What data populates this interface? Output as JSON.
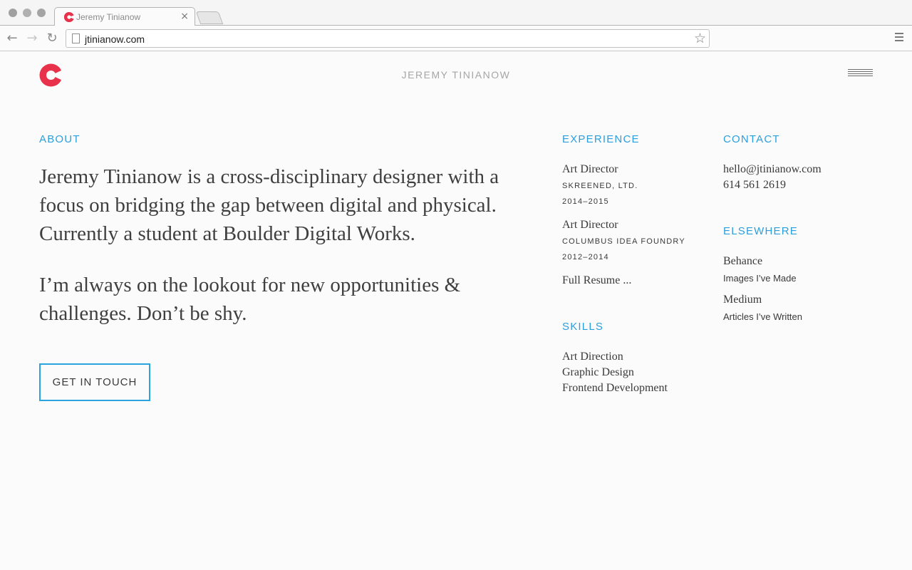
{
  "browser": {
    "tab_title": "Jeremy Tinianow",
    "tab_close": "×",
    "url": "jtinianow.com",
    "back_icon": "arrow-left-icon",
    "forward_icon": "arrow-right-icon",
    "reload_icon": "reload-icon",
    "star_icon": "star-icon",
    "menu_icon": "menu-icon",
    "brand_color": "#e8324b"
  },
  "header": {
    "site_title": "JEREMY TINIANOW"
  },
  "about": {
    "heading": "ABOUT",
    "paragraph1": "Jeremy Tinianow is a cross-disciplinary designer with a focus on bridging the gap between digital and physical. Currently a student at Boulder Digital Works.",
    "paragraph2": "I’m always on the lookout for new opportunities & challenges. Don’t be shy.",
    "cta_label": "GET IN TOUCH",
    "accent_color": "#2a9fde"
  },
  "experience": {
    "heading": "EXPERIENCE",
    "jobs": [
      {
        "title": "Art Director",
        "company": "SKREENED, LTD.",
        "years": "2014–2015"
      },
      {
        "title": "Art Director",
        "company": "COLUMBUS IDEA FOUNDRY",
        "years": "2012–2014"
      }
    ],
    "resume_link": "Full Resume ..."
  },
  "skills": {
    "heading": "SKILLS",
    "items": [
      "Art Direction",
      "Graphic Design",
      "Frontend Development"
    ]
  },
  "contact": {
    "heading": "CONTACT",
    "email": "hello@jtinianow.com",
    "phone": "614 561 2619"
  },
  "elsewhere": {
    "heading": "ELSEWHERE",
    "links": [
      {
        "name": "Behance",
        "caption": "Images I’ve Made"
      },
      {
        "name": "Medium",
        "caption": "Articles I’ve Written"
      }
    ]
  }
}
